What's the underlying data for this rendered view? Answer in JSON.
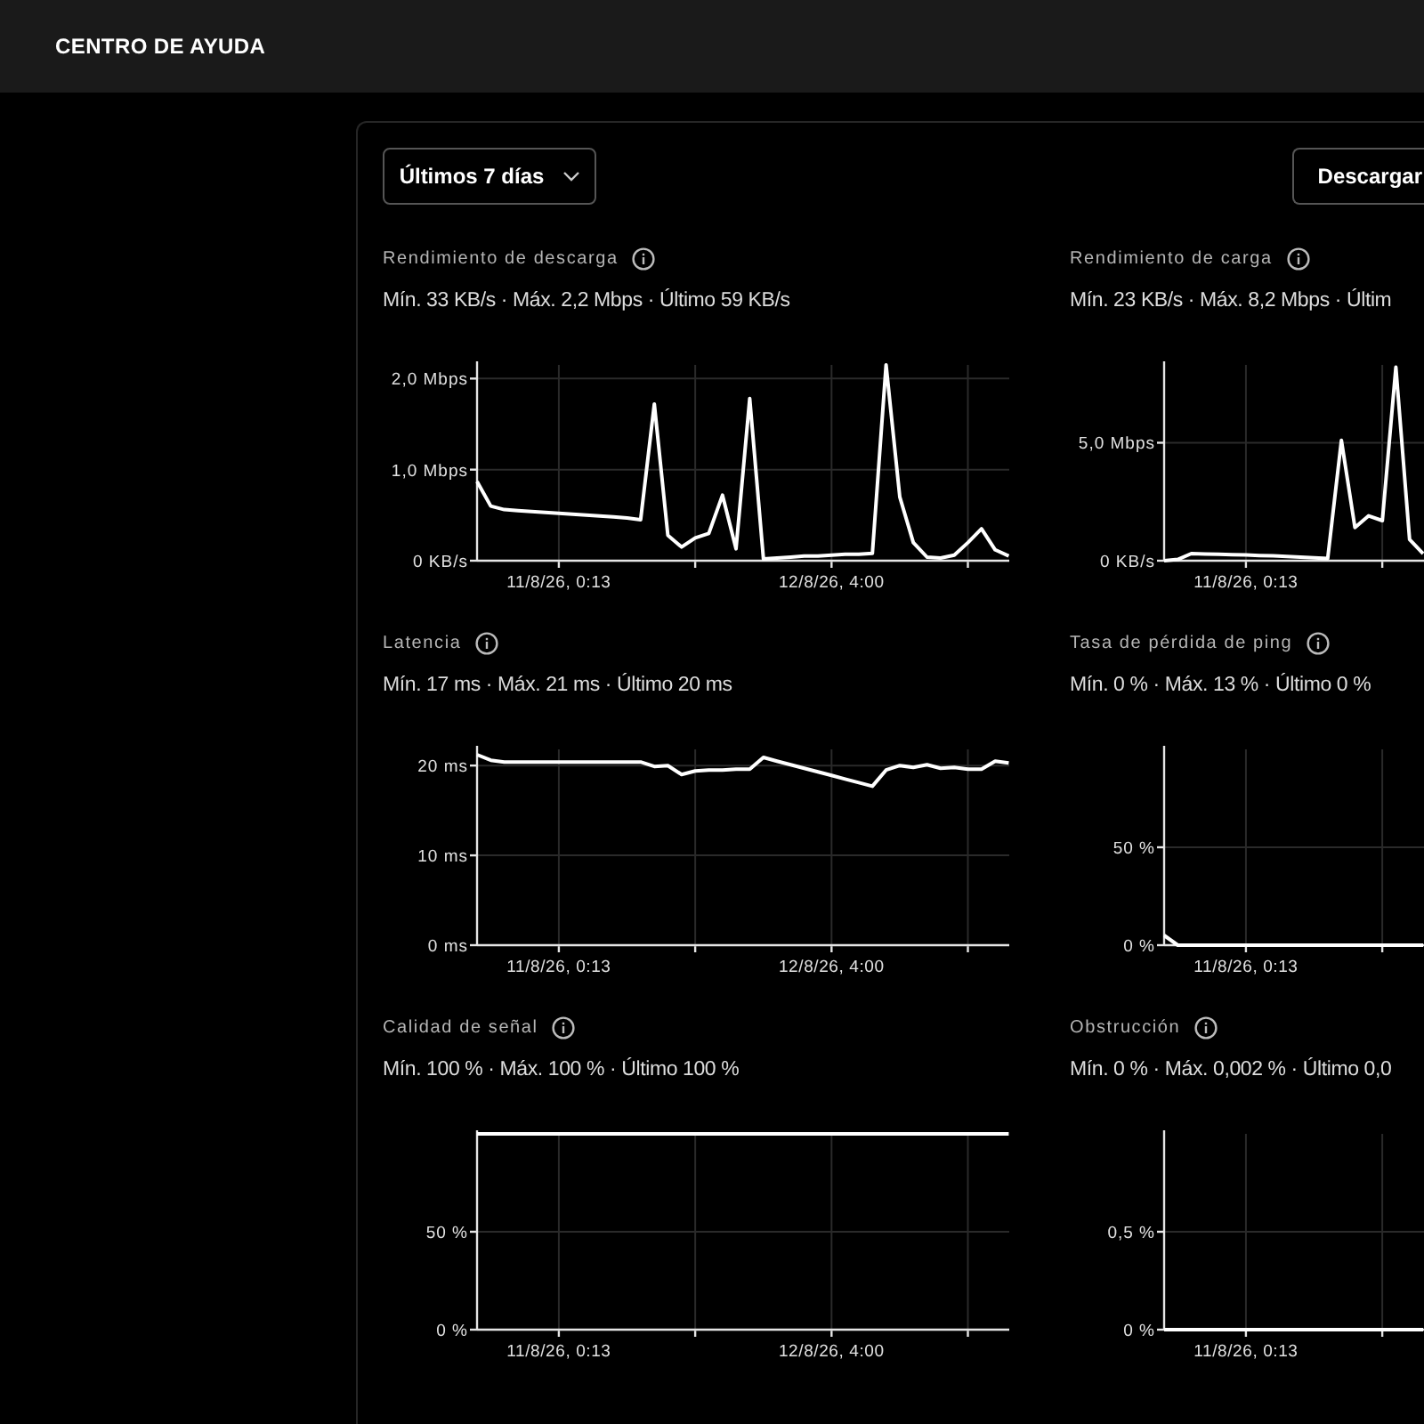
{
  "header": {
    "nav_items": [
      "CENTRO DE AYUDA"
    ]
  },
  "toolbar": {
    "range_dropdown": "Últimos 7 días",
    "download_button": "Descargar"
  },
  "panels": [
    {
      "title": "Rendimiento de descarga",
      "stats": "Mín. 33 KB/s · Máx. 2,2 Mbps · Último 59 KB/s",
      "chart_data": {
        "grid": true,
        "type": "line",
        "categories": [
          null,
          null,
          null,
          null,
          null,
          null,
          "11/8/26, 0:13",
          null,
          null,
          null,
          null,
          null,
          null,
          null,
          null,
          null,
          null,
          null,
          null,
          null,
          null,
          null,
          null,
          null,
          null,
          null,
          "12/8/26, 4:00",
          null,
          null,
          null,
          null,
          null,
          null,
          null,
          null,
          null,
          null,
          null,
          null,
          null
        ],
        "series": [
          {
            "color": "#ffffff",
            "values": [
              0.87,
              0.6,
              0.56,
              0.55,
              0.54,
              0.53,
              0.52,
              0.51,
              0.5,
              0.49,
              0.48,
              0.47,
              0.45,
              1.72,
              0.28,
              0.15,
              0.25,
              0.3,
              0.72,
              0.13,
              1.78,
              0.02,
              0.03,
              0.04,
              0.05,
              0.05,
              0.06,
              0.07,
              0.07,
              0.08,
              2.15,
              0.7,
              0.2,
              0.04,
              0.03,
              0.06,
              0.2,
              0.35,
              0.12,
              0.05
            ]
          }
        ],
        "ylim": [
          0,
          2.15
        ],
        "yticks": [
          {
            "value": 0,
            "label": "0 KB/s"
          },
          {
            "value": 1,
            "label": "1,0 Mbps"
          },
          {
            "value": 2,
            "label": "2,0 Mbps"
          }
        ]
      }
    },
    {
      "title": "Rendimiento de carga",
      "stats": "Mín. 23 KB/s · Máx. 8,2 Mbps · Últim",
      "chart_data": {
        "grid": true,
        "type": "line",
        "categories": [
          null,
          null,
          null,
          null,
          null,
          null,
          "11/8/26, 0:13",
          null,
          null,
          null,
          null,
          null,
          null,
          null,
          null,
          null,
          null,
          null,
          null,
          null
        ],
        "series": [
          {
            "color": "#ffffff",
            "values": [
              0,
              0.05,
              0.3,
              0.29,
              0.27,
              0.26,
              0.24,
              0.22,
              0.2,
              0.18,
              0.15,
              0.12,
              0.1,
              5.1,
              1.4,
              1.9,
              1.7,
              8.2,
              0.9,
              0.3
            ]
          }
        ],
        "ylim": [
          0,
          8.3
        ],
        "yticks": [
          {
            "value": 0,
            "label": "0 KB/s"
          },
          {
            "value": 5,
            "label": "5,0 Mbps"
          }
        ]
      }
    },
    {
      "title": "Latencia",
      "stats": "Mín. 17 ms · Máx. 21 ms · Último 20 ms",
      "chart_data": {
        "grid": true,
        "type": "line",
        "categories": [
          null,
          null,
          null,
          null,
          null,
          null,
          "11/8/26, 0:13",
          null,
          null,
          null,
          null,
          null,
          null,
          null,
          null,
          null,
          null,
          null,
          null,
          null,
          null,
          null,
          null,
          null,
          null,
          null,
          "12/8/26, 4:00",
          null,
          null,
          null,
          null,
          null,
          null,
          null,
          null,
          null,
          null,
          null,
          null,
          null
        ],
        "series": [
          {
            "color": "#ffffff",
            "values": [
              21.2,
              20.6,
              20.4,
              20.4,
              20.4,
              20.4,
              20.4,
              20.4,
              20.4,
              20.4,
              20.4,
              20.4,
              20.4,
              19.9,
              20,
              19,
              19.4,
              19.5,
              19.5,
              19.6,
              19.6,
              20.9,
              20.5,
              20.1,
              19.7,
              19.3,
              18.9,
              18.5,
              18.1,
              17.7,
              19.5,
              20,
              19.8,
              20.1,
              19.7,
              19.8,
              19.6,
              19.6,
              20.5,
              20.3
            ]
          }
        ],
        "ylim": [
          0,
          21.8
        ],
        "yticks": [
          {
            "value": 0,
            "label": "0 ms"
          },
          {
            "value": 10,
            "label": "10 ms"
          },
          {
            "value": 20,
            "label": "20 ms"
          }
        ]
      }
    },
    {
      "title": "Tasa de pérdida de ping",
      "stats": "Mín. 0 % · Máx. 13 % · Último 0 %",
      "chart_data": {
        "grid": true,
        "type": "line",
        "categories": [
          null,
          null,
          null,
          null,
          null,
          null,
          "11/8/26, 0:13",
          null,
          null,
          null,
          null,
          null,
          null,
          null,
          null,
          null,
          null,
          null,
          null,
          null
        ],
        "series": [
          {
            "color": "#ffffff",
            "values": [
              5,
              0,
              0,
              0,
              0,
              0,
              0,
              0,
              0,
              0,
              0,
              0,
              0,
              0,
              0,
              0,
              0,
              0,
              0,
              0
            ]
          }
        ],
        "ylim": [
          0,
          100
        ],
        "yticks": [
          {
            "value": 0,
            "label": "0 %"
          },
          {
            "value": 50,
            "label": "50 %"
          }
        ]
      }
    },
    {
      "title": "Calidad de señal",
      "stats": "Mín. 100 % · Máx. 100 % · Último 100 %",
      "chart_data": {
        "grid": true,
        "type": "line",
        "categories": [
          null,
          null,
          null,
          null,
          null,
          null,
          "11/8/26, 0:13",
          null,
          null,
          null,
          null,
          null,
          null,
          null,
          null,
          null,
          null,
          null,
          null,
          null,
          null,
          null,
          null,
          null,
          null,
          null,
          "12/8/26, 4:00",
          null,
          null,
          null,
          null,
          null,
          null,
          null,
          null,
          null,
          null,
          null,
          null,
          null
        ],
        "series": [
          {
            "color": "#ffffff",
            "values": [
              100,
              100,
              100,
              100,
              100,
              100,
              100,
              100,
              100,
              100,
              100,
              100,
              100,
              100,
              100,
              100,
              100,
              100,
              100,
              100,
              100,
              100,
              100,
              100,
              100,
              100,
              100,
              100,
              100,
              100,
              100,
              100,
              100,
              100,
              100,
              100,
              100,
              100,
              100,
              100
            ]
          }
        ],
        "ylim": [
          0,
          100
        ],
        "yticks": [
          {
            "value": 0,
            "label": "0 %"
          },
          {
            "value": 50,
            "label": "50 %"
          }
        ]
      }
    },
    {
      "title": "Obstrucción",
      "stats": "Mín. 0 % · Máx. 0,002 % · Último 0,0",
      "chart_data": {
        "grid": true,
        "type": "line",
        "categories": [
          null,
          null,
          null,
          null,
          null,
          null,
          "11/8/26, 0:13",
          null,
          null,
          null,
          null,
          null,
          null,
          null,
          null,
          null,
          null,
          null,
          null,
          null
        ],
        "series": [
          {
            "color": "#ffffff",
            "values": [
              0,
              0,
              0,
              0,
              0,
              0,
              0,
              0,
              0,
              0,
              0,
              0,
              0,
              0,
              0,
              0,
              0,
              0,
              0,
              0
            ]
          }
        ],
        "ylim": [
          0,
          1
        ],
        "yticks": [
          {
            "value": 0,
            "label": "0 %"
          },
          {
            "value": 0.5,
            "label": "0,5 %"
          }
        ]
      }
    }
  ]
}
